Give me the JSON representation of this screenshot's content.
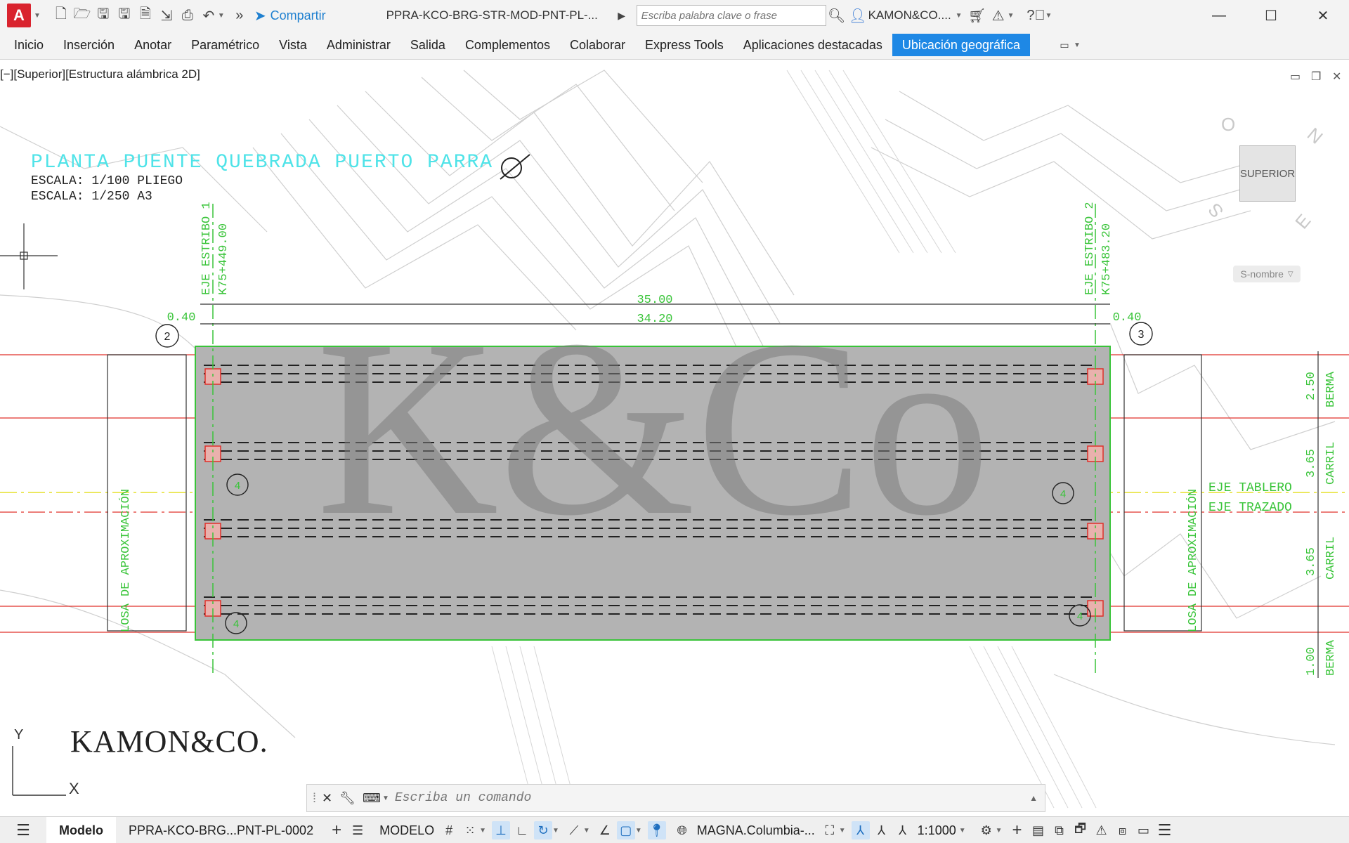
{
  "titlebar": {
    "app_letter": "A",
    "share_label": "Compartir",
    "doc_title": "PPRA-KCO-BRG-STR-MOD-PNT-PL-...",
    "search_placeholder": "Escriba palabra clave o frase",
    "user_name": "KAMON&CO...."
  },
  "ribbon": {
    "tabs": [
      {
        "label": "Inicio"
      },
      {
        "label": "Inserción"
      },
      {
        "label": "Anotar"
      },
      {
        "label": "Paramétrico"
      },
      {
        "label": "Vista"
      },
      {
        "label": "Administrar"
      },
      {
        "label": "Salida"
      },
      {
        "label": "Complementos"
      },
      {
        "label": "Colaborar"
      },
      {
        "label": "Express Tools"
      },
      {
        "label": "Aplicaciones destacadas"
      },
      {
        "label": "Ubicación geográfica",
        "active": true
      }
    ]
  },
  "viewport": {
    "label": "[−][Superior][Estructura alámbrica 2D]",
    "viewcube_face": "SUPERIOR",
    "compass": {
      "n": "N",
      "e": "E",
      "s": "S",
      "o": "O"
    },
    "wcs_label": "S-nombre"
  },
  "drawing": {
    "title": "PLANTA PUENTE QUEBRADA PUERTO PARRA",
    "scale_1": "ESCALA: 1/100 PLIEGO",
    "scale_2": "ESCALA: 1/250 A3",
    "abutment_1_label": "EJE ESTRIBO 1",
    "abutment_1_station": "K75+449.00",
    "abutment_2_label": "EJE ESTRIBO 2",
    "abutment_2_station": "K75+483.20",
    "dim_total": "35.00",
    "dim_inner": "34.20",
    "dim_left_offset": "0.40",
    "dim_right_offset": "0.40",
    "bubble_left": "2",
    "bubble_right": "3",
    "bubble_a": "4",
    "bubble_b": "4",
    "bubble_c": "4",
    "bubble_d": "4",
    "deck_axis": "EJE TABLERO",
    "route_axis": "EJE TRAZADO",
    "approach_slab_left": "LOSA DE APROXIMACIÓN",
    "approach_slab_right": "LOSA DE APROXIMACIÓN",
    "side_dims": [
      {
        "value": "2.50",
        "label": "BERMA"
      },
      {
        "value": "3.65",
        "label": "CARRIL"
      },
      {
        "value": "3.65",
        "label": "CARRIL"
      },
      {
        "value": "1.00",
        "label": "BERMA"
      }
    ],
    "ucs_y": "Y",
    "ucs_x": "X",
    "watermark": "K&Co",
    "company_logo": "KAMON&CO."
  },
  "command": {
    "placeholder": "Escriba un comando"
  },
  "statusbar": {
    "model_tab": "Modelo",
    "layout_tab": "PPRA-KCO-BRG...PNT-PL-0002",
    "space_label": "MODELO",
    "coordinate_system": "MAGNA.Columbia-...",
    "annotation_scale": "1:1000"
  },
  "colors": {
    "accent": "#1e88e5",
    "title_cyan": "#4fe3e8",
    "green": "#39c439",
    "red": "#e0302a",
    "yellow": "#e6e12a",
    "deck_gray": "#b3b3b3"
  }
}
